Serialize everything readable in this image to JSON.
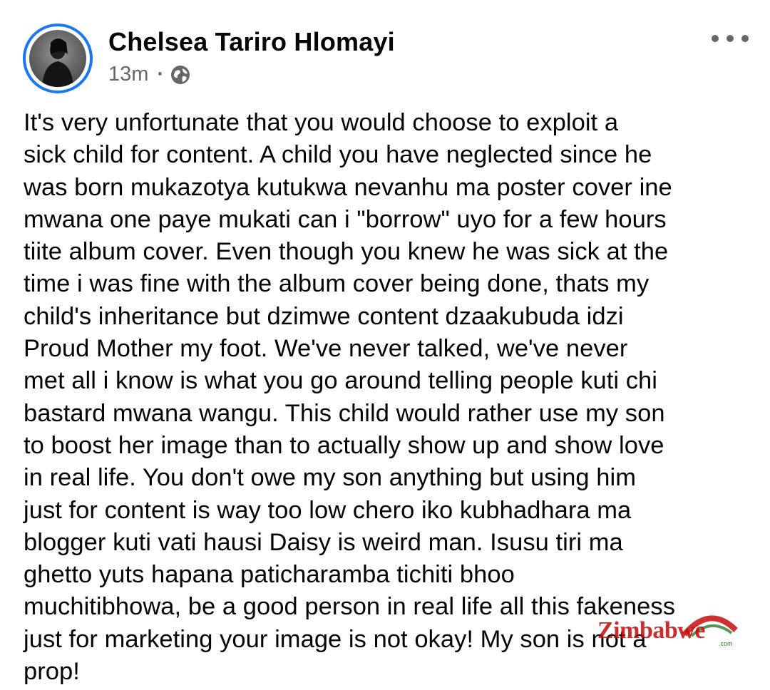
{
  "post": {
    "author": {
      "name": "Chelsea Tariro Hlomayi",
      "avatar_icon": "profile-photo"
    },
    "meta": {
      "time": "13m",
      "separator": "·",
      "audience_icon": "globe-icon"
    },
    "more_icon": "more-options-icon",
    "text": "It's very unfortunate that you would choose to exploit a\nsick child for content. A child you have neglected since he\nwas born mukazotya kutukwa nevanhu ma poster cover ine\nmwana one paye mukati can i \"borrow\" uyo for a few hours\ntiite album cover. Even though you knew he was sick at the\ntime i was fine with the album cover being done, thats my\nchild's inheritance but dzimwe content dzaakubuda idzi\nProud Mother my foot. We've never talked, we've never\nmet all i know is what you go around telling people kuti chi\nbastard mwana wangu. This child would rather use my son\nto boost her image than to actually show up and show love\nin real life. You don't owe my son anything but using him\njust for content is way too low chero iko kubhadhara ma\nblogger kuti vati hausi Daisy is weird man. Isusu tiri ma\nghetto yuts hapana paticharamba tichiti bhoo\nmuchitibhowa, be a good person in real life all this fakeness\njust for marketing your image is not okay! My son is not a\nprop!"
  },
  "watermark": {
    "text": "Zimbabwe",
    "suffix": ".com"
  },
  "colors": {
    "avatar_ring": "#1877f2",
    "meta_text": "#65676b",
    "body_text": "#050505",
    "watermark_red": "#c40f0f",
    "watermark_green": "#2f7d2f"
  }
}
